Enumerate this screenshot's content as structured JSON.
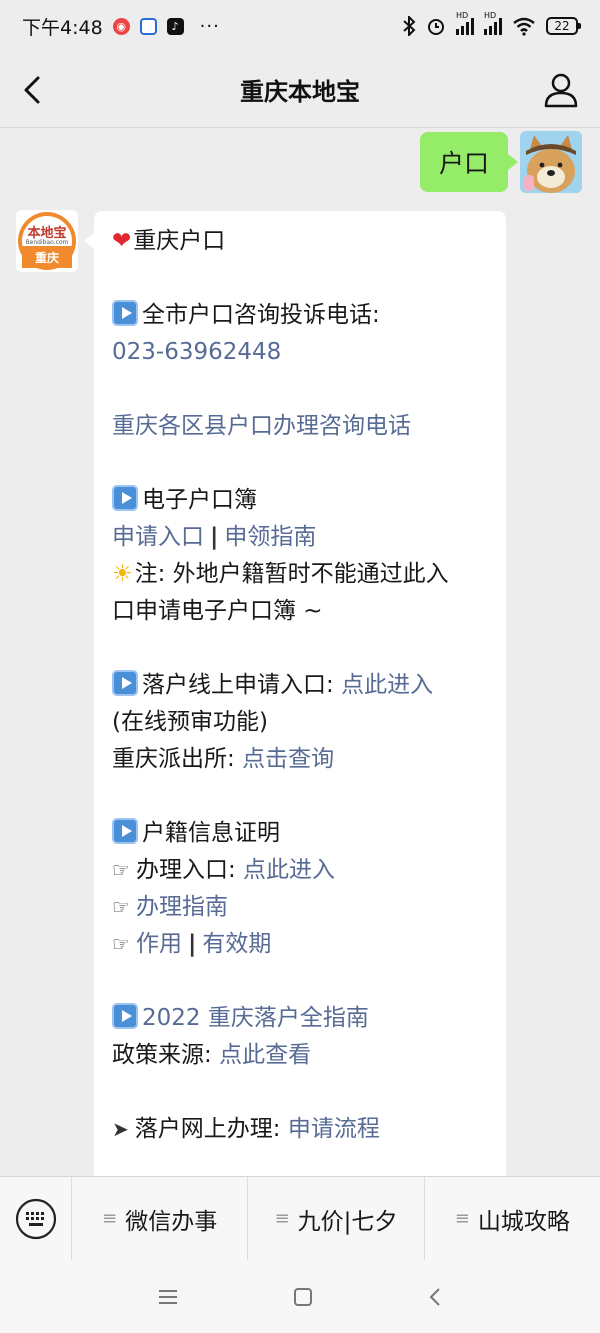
{
  "status_bar": {
    "time": "下午4:48",
    "more": "···",
    "battery": "22",
    "signal_label": "HD"
  },
  "nav": {
    "title": "重庆本地宝"
  },
  "chat": {
    "my_message": "户口",
    "bot_avatar": {
      "brand": "本地宝",
      "domain": "Bendibao.com",
      "city": "重庆"
    },
    "message": {
      "title": "重庆户口",
      "s1_heading": "全市户口咨询投诉电话:",
      "s1_phone": "023-63962448",
      "s1_district_link": "重庆各区县户口办理咨询电话",
      "s2_heading": "电子户口簿",
      "s2_link1": "申请入口",
      "s2_link2": "申领指南",
      "s2_note_line1": "注: 外地户籍暂时不能通过此入",
      "s2_note_line2": "口申请电子户口簿 ~",
      "s3_heading": "落户线上申请入口: ",
      "s3_link": "点此进入",
      "s3_note": "(在线预审功能)",
      "s3_police_label": "重庆派出所: ",
      "s3_police_link": "点击查询",
      "s4_heading": "户籍信息证明",
      "s4_entry_label": "办理入口: ",
      "s4_entry_link": "点此进入",
      "s4_guide_link": "办理指南",
      "s4_use_link": "作用",
      "s4_validity_link": "有效期",
      "s5_heading": "2022 重庆落户全指南",
      "s5_source_label": "政策来源: ",
      "s5_source_link": "点此查看",
      "s6_label": "落户网上办理: ",
      "s6_link": "申请流程",
      "separator": "|"
    }
  },
  "bottom_menu": {
    "items": [
      "微信办事",
      "九价|七夕",
      "山城攻略"
    ]
  },
  "colors": {
    "link": "#576b95",
    "my_bubble": "#95ec69",
    "background": "#ededed"
  }
}
